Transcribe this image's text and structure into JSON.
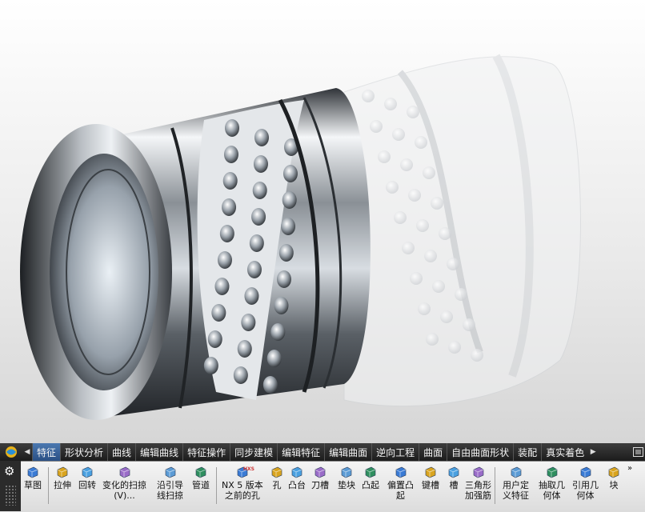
{
  "tabs": [
    {
      "label": "特征",
      "active": true
    },
    {
      "label": "形状分析"
    },
    {
      "label": "曲线"
    },
    {
      "label": "编辑曲线"
    },
    {
      "label": "特征操作"
    },
    {
      "label": "同步建模"
    },
    {
      "label": "编辑特征"
    },
    {
      "label": "编辑曲面"
    },
    {
      "label": "逆向工程"
    },
    {
      "label": "曲面"
    },
    {
      "label": "自由曲面形状"
    },
    {
      "label": "装配"
    },
    {
      "label": "真实着色"
    }
  ],
  "tools": [
    {
      "l1": "草图",
      "l2": "",
      "icon": "sketch-icon"
    },
    {
      "l1": "拉伸",
      "l2": "",
      "icon": "extrude-icon"
    },
    {
      "l1": "回转",
      "l2": "",
      "icon": "revolve-icon"
    },
    {
      "l1": "变化的扫掠",
      "l2": "(V)...",
      "icon": "variational-sweep-icon"
    },
    {
      "l1": "沿引导",
      "l2": "线扫掠",
      "icon": "sweep-along-guide-icon"
    },
    {
      "l1": "管道",
      "l2": "",
      "icon": "tube-icon"
    },
    {
      "l1": "NX 5 版本",
      "l2": "之前的孔",
      "icon": "legacy-hole-icon"
    },
    {
      "l1": "孔",
      "l2": "",
      "icon": "hole-icon"
    },
    {
      "l1": "凸台",
      "l2": "",
      "icon": "boss-icon"
    },
    {
      "l1": "刀槽",
      "l2": "",
      "icon": "pocket-icon"
    },
    {
      "l1": "垫块",
      "l2": "",
      "icon": "pad-icon"
    },
    {
      "l1": "凸起",
      "l2": "",
      "icon": "emboss-icon"
    },
    {
      "l1": "偏置凸",
      "l2": "起",
      "icon": "offset-emboss-icon"
    },
    {
      "l1": "键槽",
      "l2": "",
      "icon": "slot-icon"
    },
    {
      "l1": "槽",
      "l2": "",
      "icon": "groove-icon"
    },
    {
      "l1": "三角形",
      "l2": "加强筋",
      "icon": "dart-icon"
    },
    {
      "l1": "用户定",
      "l2": "义特征",
      "icon": "user-defined-feature-icon"
    },
    {
      "l1": "抽取几",
      "l2": "何体",
      "icon": "extract-geometry-icon"
    },
    {
      "l1": "引用几",
      "l2": "何体",
      "icon": "instance-geometry-icon"
    },
    {
      "l1": "块",
      "l2": "",
      "icon": "block-icon"
    }
  ],
  "legacy_badge": "HXS",
  "more_symbol": "»",
  "colors": {
    "tab_active": "#3a66a0",
    "ribbon": "#e6e6e6",
    "sidebar": "#2b2b2b"
  }
}
